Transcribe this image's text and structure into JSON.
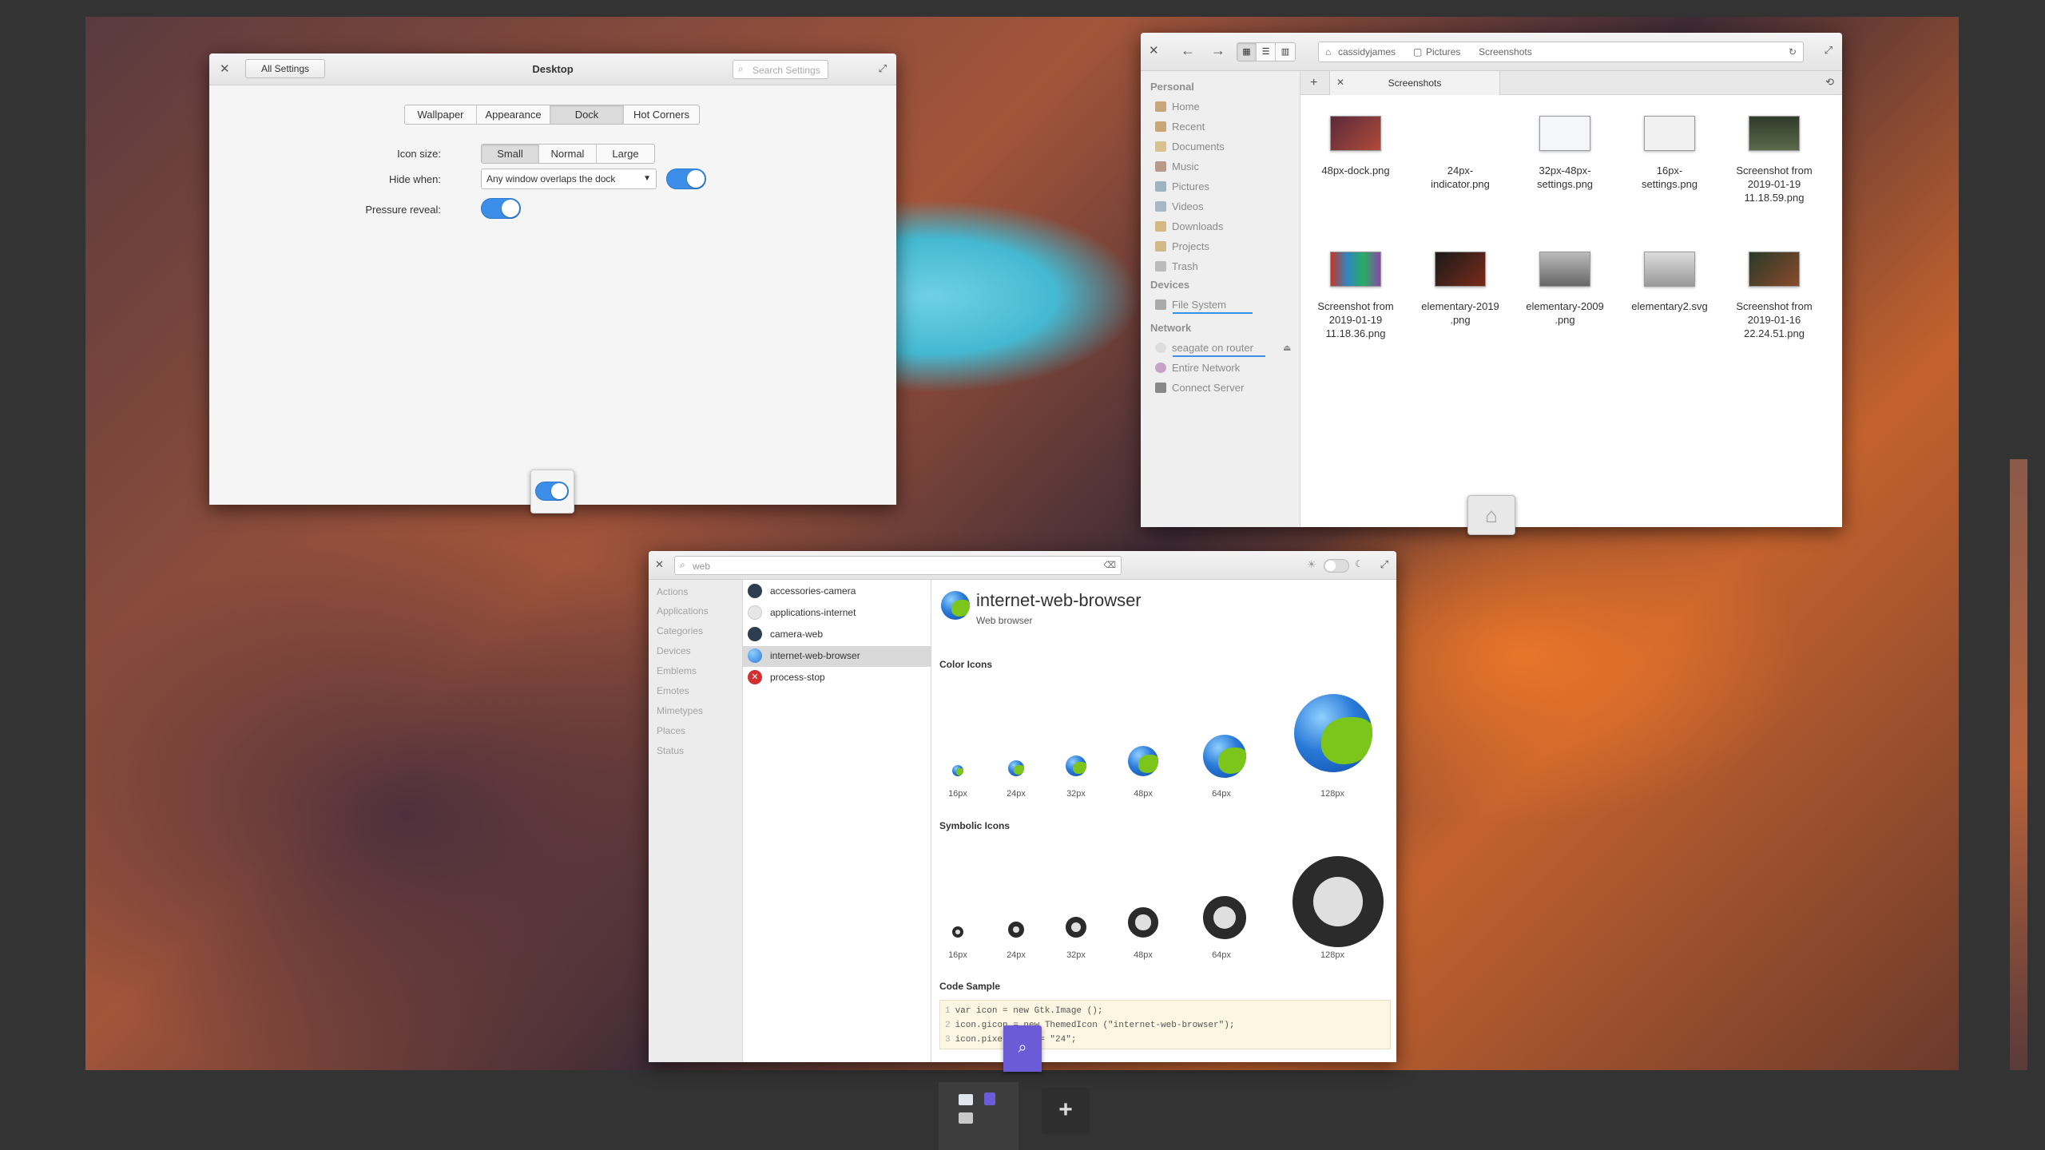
{
  "settings": {
    "back": "All Settings",
    "title": "Desktop",
    "search_placeholder": "Search Settings",
    "tabs": [
      "Wallpaper",
      "Appearance",
      "Dock",
      "Hot Corners"
    ],
    "icon_size_label": "Icon size:",
    "icon_sizes": [
      "Small",
      "Normal",
      "Large"
    ],
    "hide_label": "Hide when:",
    "hide_value": "Any window overlaps the dock",
    "pressure_label": "Pressure reveal:"
  },
  "files": {
    "path": [
      "cassidyjames",
      "Pictures",
      "Screenshots"
    ],
    "tab": "Screenshots",
    "sidebar": {
      "personal": "Personal",
      "items": [
        "Home",
        "Recent",
        "Documents",
        "Music",
        "Pictures",
        "Videos",
        "Downloads",
        "Projects",
        "Trash"
      ],
      "devices": "Devices",
      "device_items": [
        "File System"
      ],
      "network": "Network",
      "network_items": [
        "seagate on router",
        "Entire Network",
        "Connect Server"
      ]
    },
    "grid": [
      {
        "l1": "48px-dock.png",
        "l2": "",
        "l3": ""
      },
      {
        "l1": "24px-",
        "l2": "indicator.png",
        "l3": ""
      },
      {
        "l1": "32px-48px-",
        "l2": "settings.png",
        "l3": ""
      },
      {
        "l1": "16px-",
        "l2": "settings.png",
        "l3": ""
      },
      {
        "l1": "Screenshot from",
        "l2": "2019-01-19",
        "l3": "11.18.59.png"
      },
      {
        "l1": "Screenshot from",
        "l2": "2019-01-19",
        "l3": "11.18.36.png"
      },
      {
        "l1": "elementary-2019",
        "l2": ".png",
        "l3": ""
      },
      {
        "l1": "elementary-2009",
        "l2": ".png",
        "l3": ""
      },
      {
        "l1": "elementary2.svg",
        "l2": "",
        "l3": ""
      },
      {
        "l1": "Screenshot from",
        "l2": "2019-01-16",
        "l3": "22.24.51.png"
      }
    ]
  },
  "icons": {
    "search": "web",
    "categories": [
      "Actions",
      "Applications",
      "Categories",
      "Devices",
      "Emblems",
      "Emotes",
      "Mimetypes",
      "Places",
      "Status"
    ],
    "results": [
      "accessories-camera",
      "applications-internet",
      "camera-web",
      "internet-web-browser",
      "process-stop"
    ],
    "title": "internet-web-browser",
    "subtitle": "Web browser",
    "color_heading": "Color Icons",
    "symbolic_heading": "Symbolic Icons",
    "sizes": [
      "16px",
      "24px",
      "32px",
      "48px",
      "64px",
      "128px"
    ],
    "code_heading": "Code Sample",
    "code": [
      {
        "n": "1",
        "t": "var icon = new Gtk.Image ();"
      },
      {
        "n": "2",
        "t": "icon.gicon = new ThemedIcon (\"internet-web-browser\");"
      },
      {
        "n": "3",
        "t": "icon.pixel_size = \"24\";"
      }
    ]
  },
  "colors": {
    "accent": "#3d8ee8"
  }
}
